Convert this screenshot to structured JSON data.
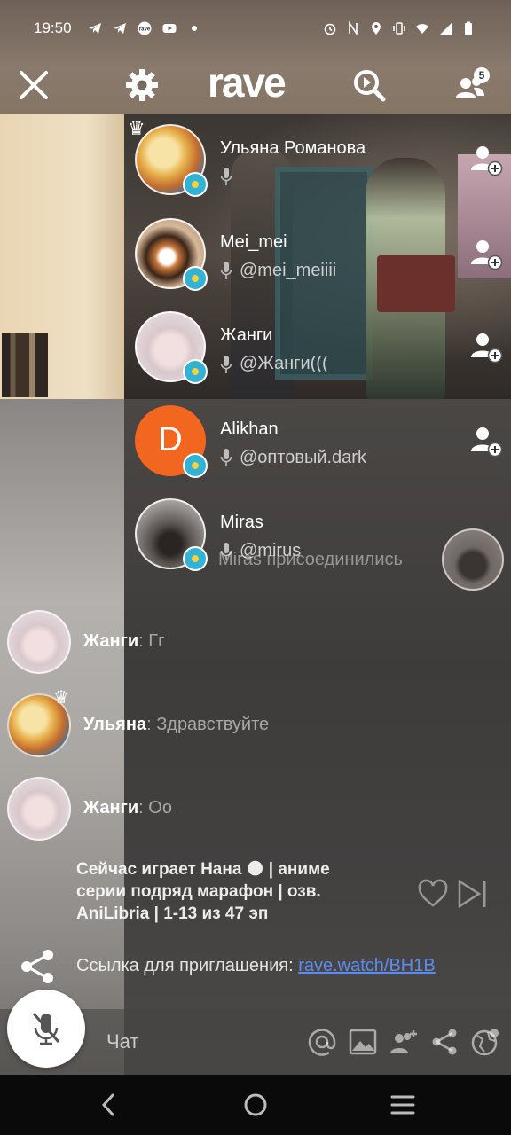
{
  "status_bar": {
    "time": "19:50",
    "left_icons": [
      "telegram-icon",
      "telegram-icon",
      "rave-icon",
      "youtube-icon",
      "dot-icon"
    ],
    "right_icons": [
      "alarm-icon",
      "nfc-icon",
      "location-icon",
      "vibrate-icon",
      "wifi-icon",
      "signal-icon",
      "battery-icon"
    ]
  },
  "header": {
    "logo": "rave",
    "users_badge": "5"
  },
  "participants": [
    {
      "name": "Ульяна Романова",
      "handle": "",
      "avatar": "anime-girl",
      "crown": true,
      "flag": "kazakhstan-flag"
    },
    {
      "name": "Mei_mei",
      "handle": "@mei_meiiii",
      "avatar": "cat",
      "crown": false,
      "flag": "kazakhstan-flag"
    },
    {
      "name": "Жанги",
      "handle": "@Жанги(((",
      "avatar": "sketch-girl",
      "crown": false,
      "flag": "kazakhstan-flag"
    },
    {
      "name": "Alikhan",
      "handle": "@оптовый.dark",
      "avatar_letter": "D",
      "avatar": "letter",
      "crown": false,
      "flag": "kazakhstan-flag"
    },
    {
      "name": "Miras",
      "handle": "@mirus",
      "avatar": "street-photo",
      "crown": false,
      "flag": "kazakhstan-flag"
    }
  ],
  "joined_notice": "Miras присоединились",
  "chat": [
    {
      "author": "Жанги",
      "sep": ": ",
      "text": "Гг"
    },
    {
      "author": "Ульяна",
      "sep": ": ",
      "text": "Здравствуйте"
    },
    {
      "author": "Жанги",
      "sep": ": ",
      "text": "Оо"
    }
  ],
  "now_playing": "Сейчас играет Нана 🌑 | аниме серии подряд марафон | озв. AniLibria | 1-13 из 47 эп",
  "invite": {
    "label": "Ссылка для приглашения: ",
    "link": "rave.watch/BH1B"
  },
  "input": {
    "placeholder": "Чат"
  },
  "colors": {
    "orange_avatar": "#f2661f",
    "link": "#5b8df0",
    "nav_bar": "#0a0a0a"
  }
}
